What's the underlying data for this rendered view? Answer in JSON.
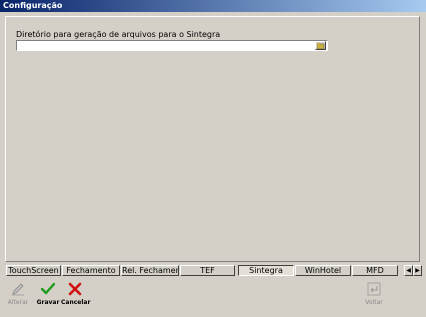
{
  "window": {
    "title": "Configuração"
  },
  "sintegra": {
    "directory_label": "Diretório para geração de arquivos para o Sintegra",
    "directory_value": ""
  },
  "tabs": [
    {
      "label": "TouchScreen",
      "active": false
    },
    {
      "label": "Fechamento",
      "active": false
    },
    {
      "label": "Rel. Fechamento",
      "active": false
    },
    {
      "label": "TEF",
      "active": false
    },
    {
      "label": "Sintegra",
      "active": true
    },
    {
      "label": "WinHotel",
      "active": false
    },
    {
      "label": "MFD",
      "active": false
    }
  ],
  "toolbar": {
    "alterar": "Alterar",
    "gravar": "Gravar",
    "cancelar": "Cancelar",
    "voltar": "Voltar"
  },
  "colors": {
    "titlebar_start": "#0a246a",
    "titlebar_end": "#a6caf0",
    "face": "#d4d0c8",
    "gravar_icon": "#1a9c1a",
    "cancelar_icon": "#d01010"
  },
  "icons": [
    "folder-browse-icon",
    "pencil-edit-icon",
    "check-icon",
    "x-cancel-icon",
    "return-icon",
    "arrow-left-icon",
    "arrow-right-icon"
  ]
}
